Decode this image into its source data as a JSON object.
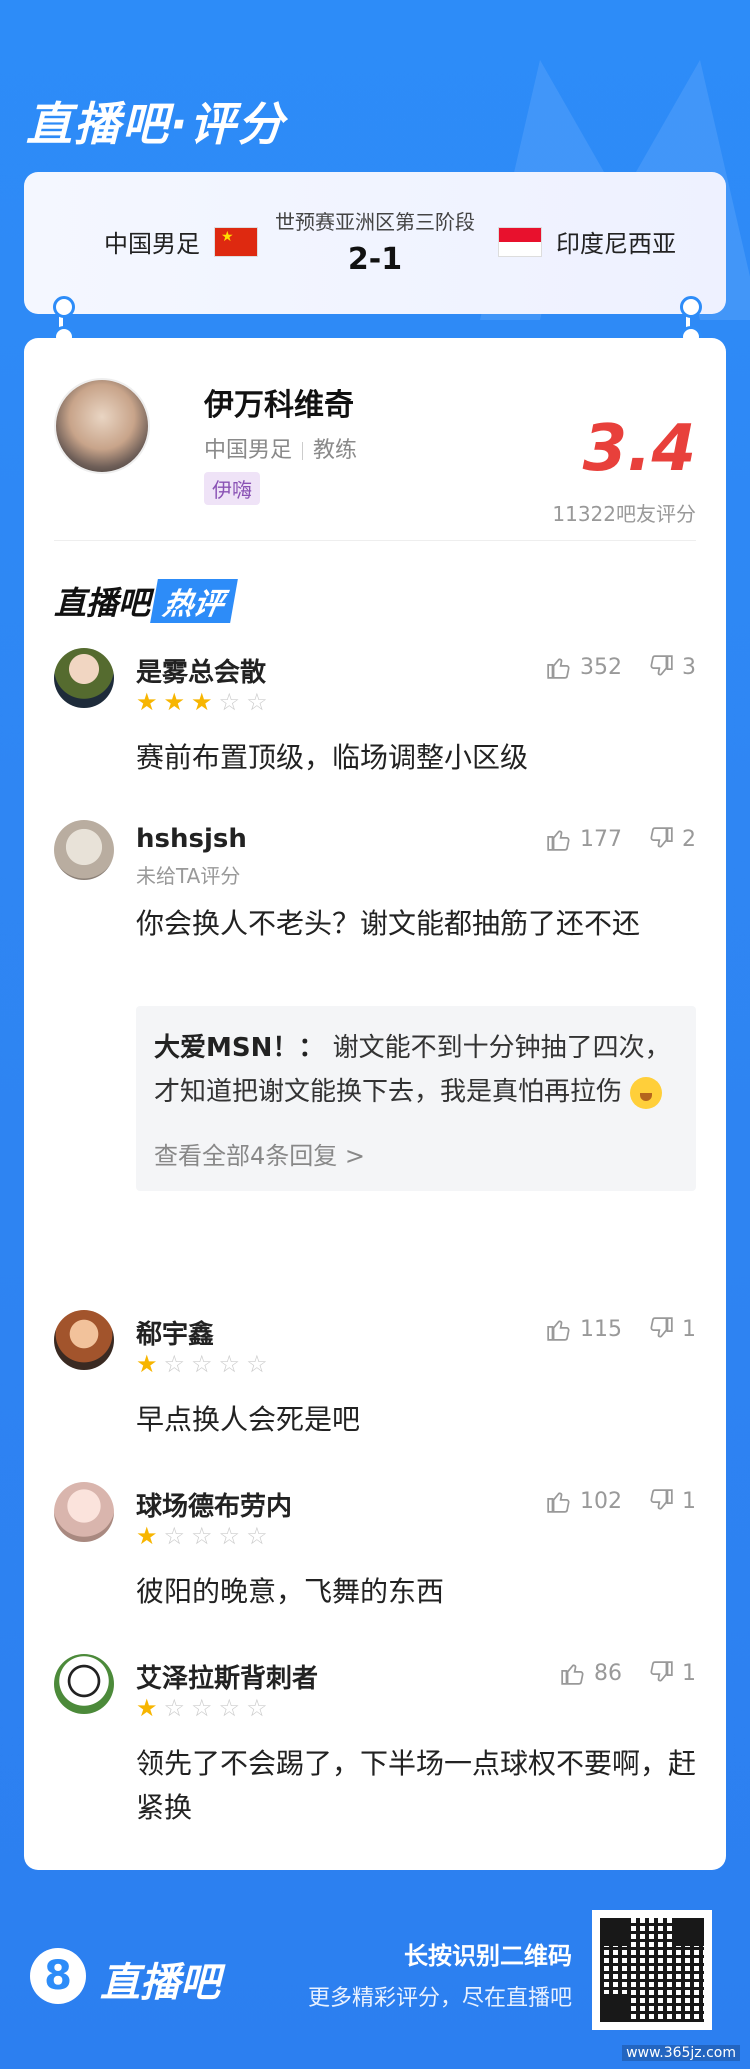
{
  "brand": {
    "title": "直播吧·评分"
  },
  "match": {
    "home_team": "中国男足",
    "away_team": "印度尼西亚",
    "stage": "世预赛亚洲区第三阶段",
    "score": "2-1"
  },
  "coach": {
    "name": "伊万科维奇",
    "team": "中国男足",
    "role": "教练",
    "tag": "伊嗨",
    "rating": "3.4",
    "rating_count": "11322吧友评分"
  },
  "hot_section": {
    "title_part1": "直播吧",
    "title_part2": "热评"
  },
  "comments": [
    {
      "user": "是雾总会散",
      "stars": 3,
      "likes": "352",
      "dislikes": "3",
      "text": "赛前布置顶级，临场调整小区级"
    },
    {
      "user": "hshsjsh",
      "sub": "未给TA评分",
      "likes": "177",
      "dislikes": "2",
      "text": "你会换人不老头？谢文能都抽筋了还不还",
      "reply": {
        "name": "大爱MSN！：",
        "text": "谢文能不到十分钟抽了四次，才知道把谢文能换下去，我是真怕再拉伤",
        "more": "查看全部4条回复 >"
      }
    },
    {
      "user": "郗宇鑫",
      "stars": 1,
      "likes": "115",
      "dislikes": "1",
      "text": "早点换人会死是吧"
    },
    {
      "user": "球场德布劳内",
      "stars": 1,
      "likes": "102",
      "dislikes": "1",
      "text": "彼阳的晚意，飞舞的东西"
    },
    {
      "user": "艾泽拉斯背刺者",
      "stars": 1,
      "likes": "86",
      "dislikes": "1",
      "text": "领先了不会踢了，下半场一点球权不要啊，赶紧换"
    }
  ],
  "footer": {
    "logo_mark": "8",
    "logo_text": "直播吧",
    "line1": "长按识别二维码",
    "line2": "更多精彩评分，尽在直播吧"
  },
  "watermark": "www.365jz.com",
  "colors": {
    "accent": "#2d8cf8",
    "rating": "#e8403b",
    "star": "#f7b500"
  }
}
